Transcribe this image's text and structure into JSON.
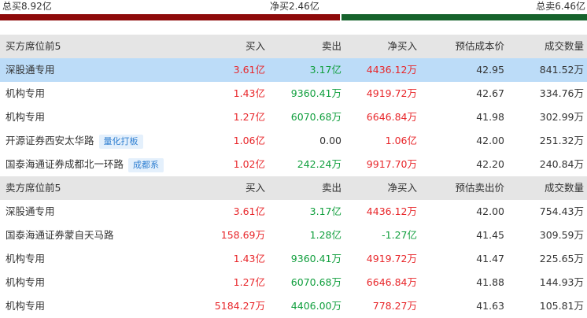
{
  "summary": {
    "buy_total": "总买8.92亿",
    "net_buy": "净买2.46亿",
    "sell_total": "总卖6.46亿"
  },
  "buy_section": {
    "headers": [
      "买方席位前5",
      "买入",
      "卖出",
      "净买入",
      "预估成本价",
      "成交数量"
    ],
    "rows": [
      {
        "name": "深股通专用",
        "tag": "",
        "buy": "3.61亿",
        "sell": "3.17亿",
        "net": "4436.12万",
        "price": "42.95",
        "volume": "841.52万"
      },
      {
        "name": "机构专用",
        "tag": "",
        "buy": "1.43亿",
        "sell": "9360.41万",
        "net": "4919.72万",
        "price": "42.67",
        "volume": "334.76万"
      },
      {
        "name": "机构专用",
        "tag": "",
        "buy": "1.27亿",
        "sell": "6070.68万",
        "net": "6646.84万",
        "price": "41.98",
        "volume": "302.99万"
      },
      {
        "name": "开源证券西安太华路",
        "tag": "量化打板",
        "buy": "1.06亿",
        "sell": "0.00",
        "net": "1.06亿",
        "price": "42.00",
        "volume": "251.32万"
      },
      {
        "name": "国泰海通证券成都北一环路",
        "tag": "成都系",
        "buy": "1.02亿",
        "sell": "242.24万",
        "net": "9917.70万",
        "price": "42.20",
        "volume": "240.84万"
      }
    ]
  },
  "sell_section": {
    "headers": [
      "卖方席位前5",
      "买入",
      "卖出",
      "净买入",
      "预估卖出价",
      "成交数量"
    ],
    "rows": [
      {
        "name": "深股通专用",
        "buy": "3.61亿",
        "sell": "3.17亿",
        "net": "4436.12万",
        "price": "42.00",
        "volume": "754.43万"
      },
      {
        "name": "国泰海通证券蒙自天马路",
        "buy": "158.69万",
        "sell": "1.28亿",
        "net": "-1.27亿",
        "price": "41.45",
        "volume": "309.59万"
      },
      {
        "name": "机构专用",
        "buy": "1.43亿",
        "sell": "9360.41万",
        "net": "4919.72万",
        "price": "41.47",
        "volume": "225.65万"
      },
      {
        "name": "机构专用",
        "buy": "1.27亿",
        "sell": "6070.68万",
        "net": "6646.84万",
        "price": "41.88",
        "volume": "144.93万"
      },
      {
        "name": "机构专用",
        "buy": "5184.27万",
        "sell": "4406.00万",
        "net": "778.27万",
        "price": "41.63",
        "volume": "105.81万"
      }
    ]
  },
  "colors": {
    "buy": "#e8262a",
    "sell": "#0f9e3c",
    "buy_bar": "#8e0a0a",
    "sell_bar": "#16632c",
    "highlight": "#bcdcf8",
    "tag_text": "#2f7fd1"
  }
}
